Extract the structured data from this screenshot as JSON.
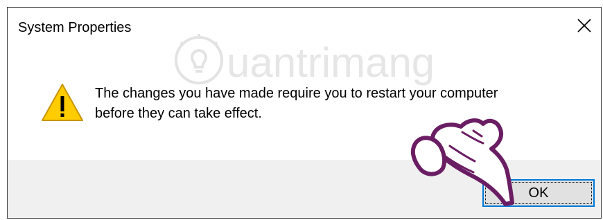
{
  "window": {
    "title": "System Properties",
    "close_glyph": "✕"
  },
  "message": {
    "line1": "The changes you have made require you to restart your computer",
    "line2": "before they can take effect.",
    "icon": "warning-icon"
  },
  "buttons": {
    "ok_label": "OK"
  },
  "watermark": {
    "text": "uantrimang",
    "logo_icon": "lightbulb-icon"
  },
  "annotation": {
    "icon": "pointing-hand-icon"
  },
  "colors": {
    "focus_border": "#0078d7",
    "warning_fill": "#ffcc00",
    "footer_bg": "#f0f0f0",
    "hand_outline": "#6a1d63"
  }
}
